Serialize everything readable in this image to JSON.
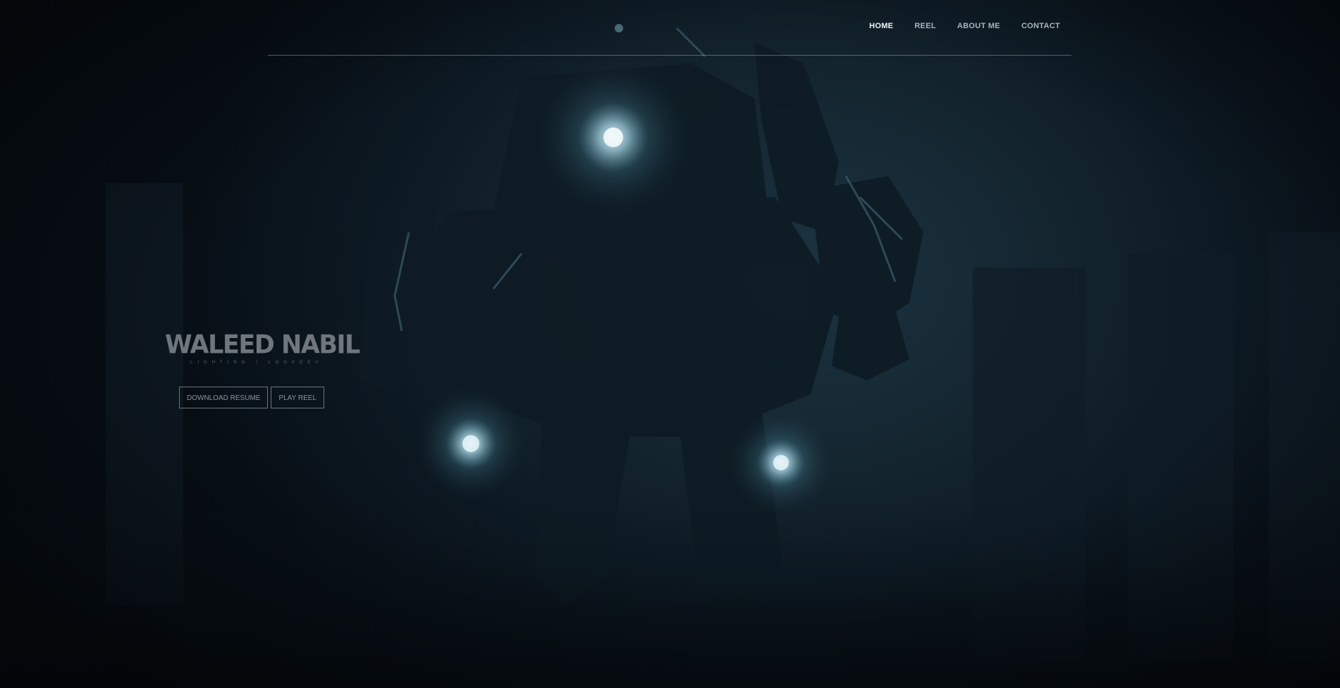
{
  "nav": {
    "items": [
      {
        "label": "HOME",
        "active": true
      },
      {
        "label": "REEL",
        "active": false
      },
      {
        "label": "ABOUT ME",
        "active": false
      },
      {
        "label": "CONTACT",
        "active": false
      }
    ]
  },
  "hero": {
    "name": "WALEED NABIL",
    "tagline": "LIGHTING / LOOKDEV",
    "buttons": {
      "resume": "DOWNLOAD RESUME",
      "reel": "PLAY REEL"
    }
  },
  "colors": {
    "background": "#0a141d",
    "nav_active": "#f2f5f7",
    "nav_inactive": "#a9b4bb",
    "light_glow": "#bfe6f2"
  }
}
